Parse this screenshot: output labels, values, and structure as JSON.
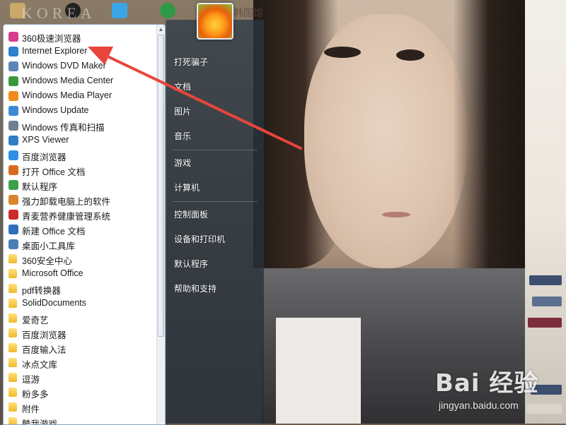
{
  "wallpaper": {
    "watermark": "KOREA",
    "watermark2": "韩国馆",
    "baidu_logo": "Bai 经验",
    "baidu_url": "jingyan.baidu.com"
  },
  "start_menu": {
    "programs": [
      {
        "label": "360极速浏览器",
        "icon": "360-browser-icon",
        "color": "#d83b8f"
      },
      {
        "label": "Internet Explorer",
        "icon": "ie-icon",
        "color": "#2c7fd1"
      },
      {
        "label": "Windows DVD Maker",
        "icon": "dvd-maker-icon",
        "color": "#5b86b4"
      },
      {
        "label": "Windows Media Center",
        "icon": "media-center-icon",
        "color": "#3a9a3a"
      },
      {
        "label": "Windows Media Player",
        "icon": "media-player-icon",
        "color": "#f08a1c"
      },
      {
        "label": "Windows Update",
        "icon": "windows-update-icon",
        "color": "#3c8ad6"
      },
      {
        "label": "Windows 传真和扫描",
        "icon": "fax-scan-icon",
        "color": "#6e7f93"
      },
      {
        "label": "XPS Viewer",
        "icon": "xps-viewer-icon",
        "color": "#2f7ec8"
      },
      {
        "label": "百度浏览器",
        "icon": "baidu-browser-icon",
        "color": "#2f8fe6"
      },
      {
        "label": "打开 Office 文档",
        "icon": "office-open-icon",
        "color": "#d76b1d"
      },
      {
        "label": "默认程序",
        "icon": "default-programs-icon",
        "color": "#3aa04a"
      },
      {
        "label": "强力卸载电脑上的软件",
        "icon": "uninstall-icon",
        "color": "#d9862a"
      },
      {
        "label": "青麦营养健康管理系统",
        "icon": "health-app-icon",
        "color": "#cc2b2b"
      },
      {
        "label": "新建 Office 文档",
        "icon": "office-new-icon",
        "color": "#2e6fbd"
      },
      {
        "label": "桌面小工具库",
        "icon": "gadgets-icon",
        "color": "#4a7fb5"
      },
      {
        "label": "360安全中心",
        "icon": "folder-icon",
        "folder": true
      },
      {
        "label": "Microsoft Office",
        "icon": "folder-icon",
        "folder": true
      },
      {
        "label": "pdf转换器",
        "icon": "folder-icon",
        "folder": true
      },
      {
        "label": "SolidDocuments",
        "icon": "folder-icon",
        "folder": true
      },
      {
        "label": "爱奇艺",
        "icon": "folder-icon",
        "folder": true
      },
      {
        "label": "百度浏览器",
        "icon": "folder-icon",
        "folder": true
      },
      {
        "label": "百度输入法",
        "icon": "folder-icon",
        "folder": true
      },
      {
        "label": "冰点文库",
        "icon": "folder-icon",
        "folder": true
      },
      {
        "label": "逗游",
        "icon": "folder-icon",
        "folder": true
      },
      {
        "label": "粉多多",
        "icon": "folder-icon",
        "folder": true
      },
      {
        "label": "附件",
        "icon": "folder-icon",
        "folder": true
      },
      {
        "label": "酷我游戏",
        "icon": "folder-icon",
        "folder": true
      }
    ],
    "right_items": [
      {
        "label": "打死骗子"
      },
      {
        "label": "文档"
      },
      {
        "label": "图片"
      },
      {
        "label": "音乐"
      },
      {
        "label": "游戏"
      },
      {
        "label": "计算机"
      },
      {
        "label": "控制面板"
      },
      {
        "label": "设备和打印机"
      },
      {
        "label": "默认程序"
      },
      {
        "label": "帮助和支持"
      }
    ]
  },
  "colors": {
    "arrow": "#e8453c",
    "menu_glass": "#2f4050"
  }
}
